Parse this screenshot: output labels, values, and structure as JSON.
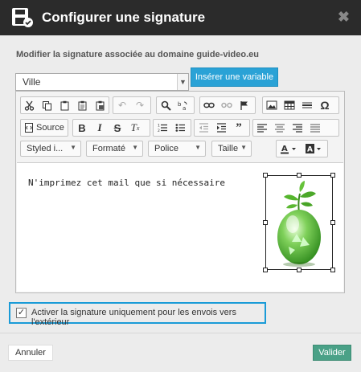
{
  "dialog": {
    "title": "Configurer une signature",
    "close_glyph": "✖",
    "subtitle": "Modifier la signature associée au domaine guide-video.eu"
  },
  "variable_select": {
    "value": "Ville"
  },
  "insert_variable_label": "Insérer une variable",
  "toolbar": {
    "source_label": "Source",
    "styles_label": "Styled i...",
    "format_label": "Formaté",
    "font_label": "Police",
    "size_label": "Taille"
  },
  "editor": {
    "content_text": "N'imprimez cet mail que si nécessaire"
  },
  "external_only": {
    "checked": true,
    "label": "Activer la signature uniquement pour les envois vers l'extérieur"
  },
  "footer": {
    "cancel_label": "Annuler",
    "validate_label": "Valider"
  },
  "colors": {
    "titlebar": "#2b2b2b",
    "insert_button": "#2aa2d6",
    "validate_button": "#4aa187",
    "highlight_border": "#1a9bd7"
  }
}
